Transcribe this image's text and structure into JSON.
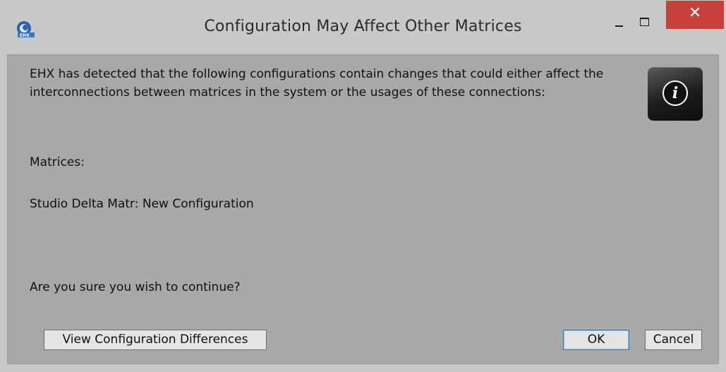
{
  "window": {
    "title": "Configuration May Affect Other Matrices",
    "close_glyph": "✕",
    "controls": [
      "minimize-icon",
      "maximize-icon",
      "close-icon"
    ],
    "accent_close": "#c7403a"
  },
  "message": {
    "intro": "EHX has detected that the following configurations contain changes that could either affect the interconnections between matrices in the system or the usages of these connections:",
    "matrices_label": "Matrices:",
    "matrix_entry": "Studio Delta Matr: New Configuration",
    "question": "Are you sure you wish to continue?"
  },
  "icons": {
    "app": "app-logo-icon",
    "info": "info-icon",
    "info_glyph": "i"
  },
  "buttons": {
    "view_diff": "View Configuration Differences",
    "ok": "OK",
    "cancel": "Cancel"
  }
}
